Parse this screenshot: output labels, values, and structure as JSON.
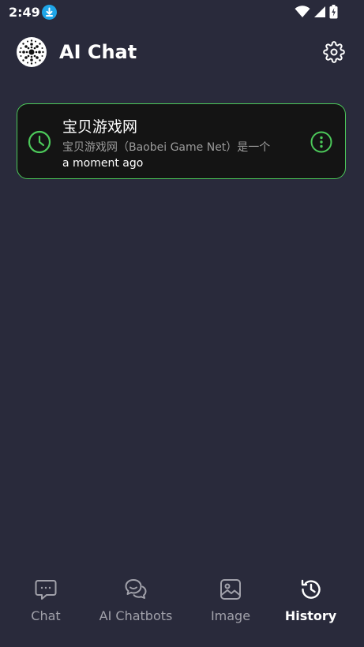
{
  "status_bar": {
    "time": "2:49"
  },
  "header": {
    "title": "AI Chat"
  },
  "history": [
    {
      "title": "宝贝游戏网",
      "preview": "宝贝游戏网（Baobei Game Net）是一个",
      "time": "a moment ago"
    }
  ],
  "nav": {
    "items": [
      {
        "label": "Chat",
        "icon": "chat-bubble-icon"
      },
      {
        "label": "AI Chatbots",
        "icon": "chatbots-icon"
      },
      {
        "label": "Image",
        "icon": "image-icon"
      },
      {
        "label": "History",
        "icon": "history-icon",
        "active": true
      }
    ]
  },
  "colors": {
    "background": "#292a3b",
    "accent": "#4cc95a",
    "card": "#141414",
    "inactive": "#a1a1aa"
  }
}
